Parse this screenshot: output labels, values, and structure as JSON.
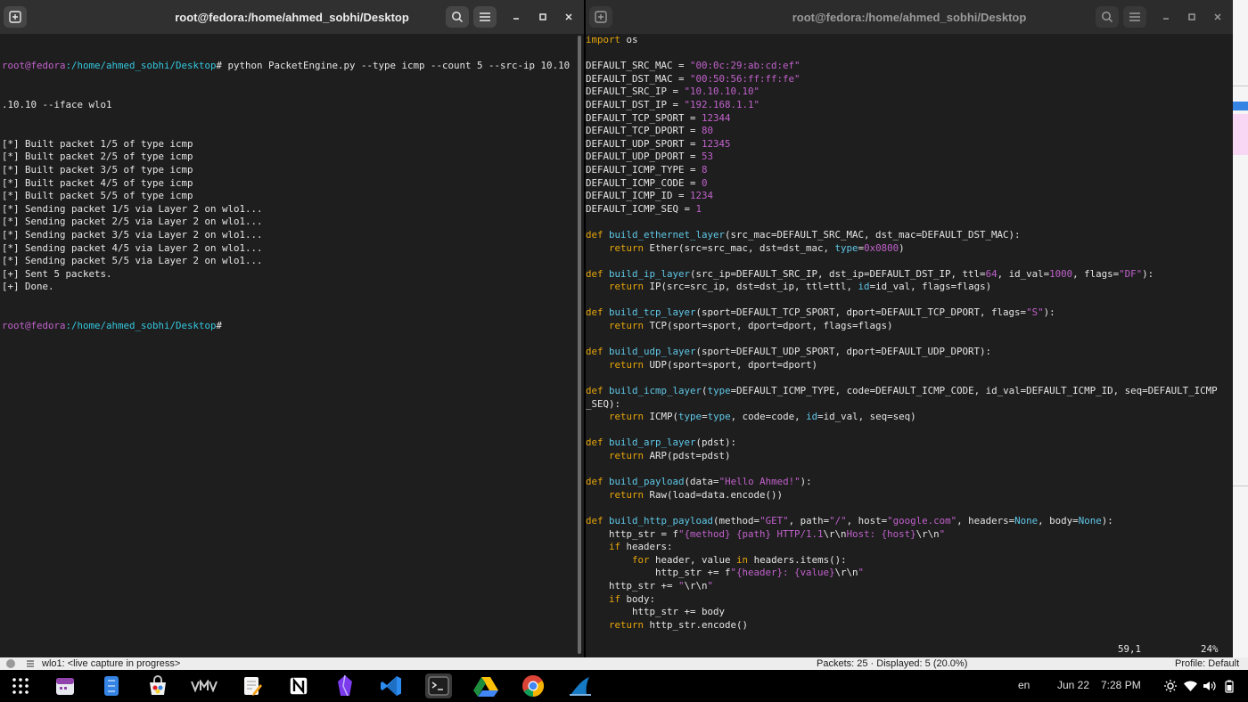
{
  "left_window": {
    "title": "root@fedora:/home/ahmed_sobhi/Desktop",
    "prompt_user": "root@fedora",
    "prompt_path": ":/home/ahmed_sobhi/Desktop",
    "prompt_hash": "#",
    "command": " python PacketEngine.py --type icmp --count 5 --src-ip 10.10",
    "command_wrap": ".10.10 --iface wlo1",
    "output": [
      "[*] Built packet 1/5 of type icmp",
      "[*] Built packet 2/5 of type icmp",
      "[*] Built packet 3/5 of type icmp",
      "[*] Built packet 4/5 of type icmp",
      "[*] Built packet 5/5 of type icmp",
      "[*] Sending packet 1/5 via Layer 2 on wlo1...",
      "[*] Sending packet 2/5 via Layer 2 on wlo1...",
      "[*] Sending packet 3/5 via Layer 2 on wlo1...",
      "[*] Sending packet 4/5 via Layer 2 on wlo1...",
      "[*] Sending packet 5/5 via Layer 2 on wlo1...",
      "[+] Sent 5 packets.",
      "[+] Done."
    ]
  },
  "right_window": {
    "title": "root@fedora:/home/ahmed_sobhi/Desktop",
    "vim_position": "59,1",
    "vim_percent": "24%",
    "code": [
      [
        [
          "kw",
          "import"
        ],
        [
          "t",
          " os"
        ]
      ],
      [],
      [
        [
          "t",
          "DEFAULT_SRC_MAC = "
        ],
        [
          "s",
          "\"00:0c:29:ab:cd:ef\""
        ]
      ],
      [
        [
          "t",
          "DEFAULT_DST_MAC = "
        ],
        [
          "s",
          "\"00:50:56:ff:ff:fe\""
        ]
      ],
      [
        [
          "t",
          "DEFAULT_SRC_IP = "
        ],
        [
          "s",
          "\"10.10.10.10\""
        ]
      ],
      [
        [
          "t",
          "DEFAULT_DST_IP = "
        ],
        [
          "s",
          "\"192.168.1.1\""
        ]
      ],
      [
        [
          "t",
          "DEFAULT_TCP_SPORT = "
        ],
        [
          "n",
          "12344"
        ]
      ],
      [
        [
          "t",
          "DEFAULT_TCP_DPORT = "
        ],
        [
          "n",
          "80"
        ]
      ],
      [
        [
          "t",
          "DEFAULT_UDP_SPORT = "
        ],
        [
          "n",
          "12345"
        ]
      ],
      [
        [
          "t",
          "DEFAULT_UDP_DPORT = "
        ],
        [
          "n",
          "53"
        ]
      ],
      [
        [
          "t",
          "DEFAULT_ICMP_TYPE = "
        ],
        [
          "n",
          "8"
        ]
      ],
      [
        [
          "t",
          "DEFAULT_ICMP_CODE = "
        ],
        [
          "n",
          "0"
        ]
      ],
      [
        [
          "t",
          "DEFAULT_ICMP_ID = "
        ],
        [
          "n",
          "1234"
        ]
      ],
      [
        [
          "t",
          "DEFAULT_ICMP_SEQ = "
        ],
        [
          "n",
          "1"
        ]
      ],
      [],
      [
        [
          "kw",
          "def"
        ],
        [
          "t",
          " "
        ],
        [
          "fn",
          "build_ethernet_layer"
        ],
        [
          "t",
          "(src_mac=DEFAULT_SRC_MAC, dst_mac=DEFAULT_DST_MAC):"
        ]
      ],
      [
        [
          "t",
          "    "
        ],
        [
          "kw",
          "return"
        ],
        [
          "t",
          " Ether(src=src_mac, dst=dst_mac, "
        ],
        [
          "kwa",
          "type"
        ],
        [
          "t",
          "="
        ],
        [
          "n",
          "0x0800"
        ],
        [
          "t",
          ")"
        ]
      ],
      [],
      [
        [
          "kw",
          "def"
        ],
        [
          "t",
          " "
        ],
        [
          "fn",
          "build_ip_layer"
        ],
        [
          "t",
          "(src_ip=DEFAULT_SRC_IP, dst_ip=DEFAULT_DST_IP, ttl="
        ],
        [
          "n",
          "64"
        ],
        [
          "t",
          ", id_val="
        ],
        [
          "n",
          "1000"
        ],
        [
          "t",
          ", flags="
        ],
        [
          "s",
          "\"DF\""
        ],
        [
          "t",
          "):"
        ]
      ],
      [
        [
          "t",
          "    "
        ],
        [
          "kw",
          "return"
        ],
        [
          "t",
          " IP(src=src_ip, dst=dst_ip, ttl=ttl, "
        ],
        [
          "kwa",
          "id"
        ],
        [
          "t",
          "=id_val, flags=flags)"
        ]
      ],
      [],
      [
        [
          "kw",
          "def"
        ],
        [
          "t",
          " "
        ],
        [
          "fn",
          "build_tcp_layer"
        ],
        [
          "t",
          "(sport=DEFAULT_TCP_SPORT, dport=DEFAULT_TCP_DPORT, flags="
        ],
        [
          "s",
          "\"S\""
        ],
        [
          "t",
          "):"
        ]
      ],
      [
        [
          "t",
          "    "
        ],
        [
          "kw",
          "return"
        ],
        [
          "t",
          " TCP(sport=sport, dport=dport, flags=flags)"
        ]
      ],
      [],
      [
        [
          "kw",
          "def"
        ],
        [
          "t",
          " "
        ],
        [
          "fn",
          "build_udp_layer"
        ],
        [
          "t",
          "(sport=DEFAULT_UDP_SPORT, dport=DEFAULT_UDP_DPORT):"
        ]
      ],
      [
        [
          "t",
          "    "
        ],
        [
          "kw",
          "return"
        ],
        [
          "t",
          " UDP(sport=sport, dport=dport)"
        ]
      ],
      [],
      [
        [
          "kw",
          "def"
        ],
        [
          "t",
          " "
        ],
        [
          "fn",
          "build_icmp_layer"
        ],
        [
          "t",
          "("
        ],
        [
          "kwa",
          "type"
        ],
        [
          "t",
          "=DEFAULT_ICMP_TYPE, code=DEFAULT_ICMP_CODE, id_val=DEFAULT_ICMP_ID, seq=DEFAULT_ICMP"
        ]
      ],
      [
        [
          "t",
          "_SEQ):"
        ]
      ],
      [
        [
          "t",
          "    "
        ],
        [
          "kw",
          "return"
        ],
        [
          "t",
          " ICMP("
        ],
        [
          "kwa",
          "type"
        ],
        [
          "t",
          "="
        ],
        [
          "kwa",
          "type"
        ],
        [
          "t",
          ", code=code, "
        ],
        [
          "kwa",
          "id"
        ],
        [
          "t",
          "=id_val, seq=seq)"
        ]
      ],
      [],
      [
        [
          "kw",
          "def"
        ],
        [
          "t",
          " "
        ],
        [
          "fn",
          "build_arp_layer"
        ],
        [
          "t",
          "(pdst):"
        ]
      ],
      [
        [
          "t",
          "    "
        ],
        [
          "kw",
          "return"
        ],
        [
          "t",
          " ARP(pdst=pdst)"
        ]
      ],
      [],
      [
        [
          "kw",
          "def"
        ],
        [
          "t",
          " "
        ],
        [
          "fn",
          "build_payload"
        ],
        [
          "t",
          "(data="
        ],
        [
          "s",
          "\"Hello Ahmed!\""
        ],
        [
          "t",
          "):"
        ]
      ],
      [
        [
          "t",
          "    "
        ],
        [
          "kw",
          "return"
        ],
        [
          "t",
          " Raw(load=data.encode())"
        ]
      ],
      [],
      [
        [
          "kw",
          "def"
        ],
        [
          "t",
          " "
        ],
        [
          "fn",
          "build_http_payload"
        ],
        [
          "t",
          "(method="
        ],
        [
          "s",
          "\"GET\""
        ],
        [
          "t",
          ", path="
        ],
        [
          "s",
          "\"/\""
        ],
        [
          "t",
          ", host="
        ],
        [
          "s",
          "\"google.com\""
        ],
        [
          "t",
          ", headers="
        ],
        [
          "kwa",
          "None"
        ],
        [
          "t",
          ", body="
        ],
        [
          "kwa",
          "None"
        ],
        [
          "t",
          "):"
        ]
      ],
      [
        [
          "t",
          "    http_str = f"
        ],
        [
          "s",
          "\""
        ],
        [
          "s",
          "{method} {path} HTTP/1.1"
        ],
        [
          "t",
          "\\r\\n"
        ],
        [
          "s",
          "Host: {host}"
        ],
        [
          "t",
          "\\r\\n"
        ],
        [
          "s",
          "\""
        ]
      ],
      [
        [
          "t",
          "    "
        ],
        [
          "kw",
          "if"
        ],
        [
          "t",
          " headers:"
        ]
      ],
      [
        [
          "t",
          "        "
        ],
        [
          "kw",
          "for"
        ],
        [
          "t",
          " header, value "
        ],
        [
          "kw",
          "in"
        ],
        [
          "t",
          " headers.items():"
        ]
      ],
      [
        [
          "t",
          "            http_str += f"
        ],
        [
          "s",
          "\"{header}: {value}"
        ],
        [
          "t",
          "\\r\\n"
        ],
        [
          "s",
          "\""
        ]
      ],
      [
        [
          "t",
          "    http_str += "
        ],
        [
          "s",
          "\""
        ],
        [
          "t",
          "\\r\\n"
        ],
        [
          "s",
          "\""
        ]
      ],
      [
        [
          "t",
          "    "
        ],
        [
          "kw",
          "if"
        ],
        [
          "t",
          " body:"
        ]
      ],
      [
        [
          "t",
          "        http_str += body"
        ]
      ],
      [
        [
          "t",
          "    "
        ],
        [
          "kw",
          "return"
        ],
        [
          "t",
          " http_str.encode()"
        ]
      ]
    ]
  },
  "wireshark_status": {
    "interface": "wlo1: <live capture in progress>",
    "packets": "Packets: 25 · Displayed: 5 (20.0%)",
    "profile": "Profile: Default"
  },
  "taskbar": {
    "language": "en",
    "date": "Jun 22",
    "time": "7:28 PM"
  }
}
